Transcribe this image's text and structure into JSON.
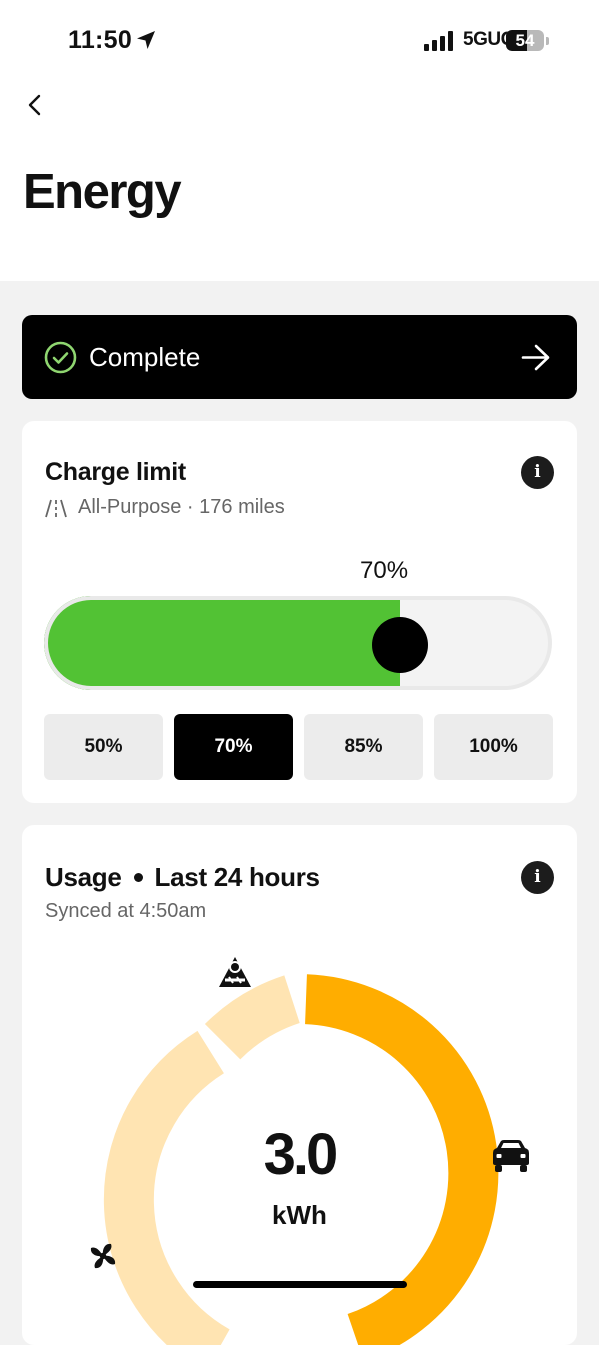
{
  "status_bar": {
    "time": "11:50",
    "network": "5GUC",
    "battery": "54",
    "battery_level_percent": 54
  },
  "header": {
    "title": "Energy"
  },
  "charge_status": {
    "label": "Complete",
    "accent_color": "#8fd670"
  },
  "charge_limit": {
    "title": "Charge limit",
    "mode": "All-Purpose",
    "range": "176 miles",
    "subtitle": "All-Purpose · 176 miles",
    "value_label": "70%",
    "value_percent": 70,
    "fill_color": "#52c234",
    "presets": [
      {
        "label": "50%",
        "selected": false
      },
      {
        "label": "70%",
        "selected": true
      },
      {
        "label": "85%",
        "selected": false
      },
      {
        "label": "100%",
        "selected": false
      }
    ]
  },
  "usage": {
    "title": "Usage",
    "period": "Last 24 hours",
    "synced": "Synced at 4:50am",
    "total_value": "3.0",
    "total_unit": "kWh",
    "colors": {
      "primary": "#ffad00",
      "secondary": "#ffe4b2"
    },
    "categories": [
      {
        "icon": "car-icon"
      },
      {
        "icon": "fan-icon"
      },
      {
        "icon": "camp-icon"
      }
    ]
  }
}
